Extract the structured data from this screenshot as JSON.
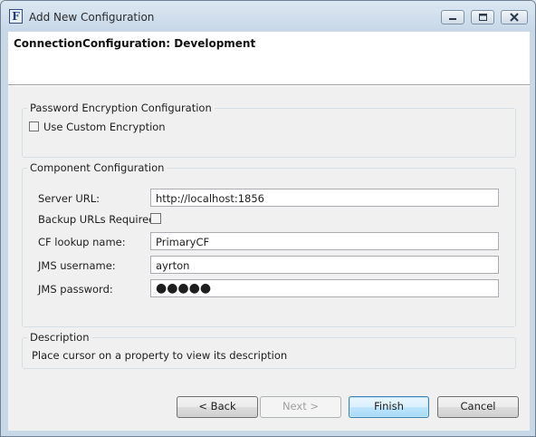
{
  "window": {
    "title": "Add New Configuration",
    "app_icon_letter": "F"
  },
  "header": {
    "title": "ConnectionConfiguration: Development"
  },
  "encryption_group": {
    "legend": "Password Encryption Configuration",
    "use_custom_label": "Use Custom Encryption",
    "use_custom_checked": false
  },
  "component_group": {
    "legend": "Component Configuration",
    "server_url_label": "Server URL:",
    "server_url_value": "http://localhost:1856",
    "backup_label": "Backup URLs Required",
    "backup_checked": false,
    "cf_label": "CF lookup name:",
    "cf_value": "PrimaryCF",
    "user_label": "JMS username:",
    "user_value": "ayrton",
    "pass_label": "JMS password:",
    "pass_masked": "●●●●●"
  },
  "description_group": {
    "legend": "Description",
    "text": "Place cursor on a property to view its description"
  },
  "buttons": {
    "back": "< Back",
    "next": "Next >",
    "finish": "Finish",
    "cancel": "Cancel"
  }
}
